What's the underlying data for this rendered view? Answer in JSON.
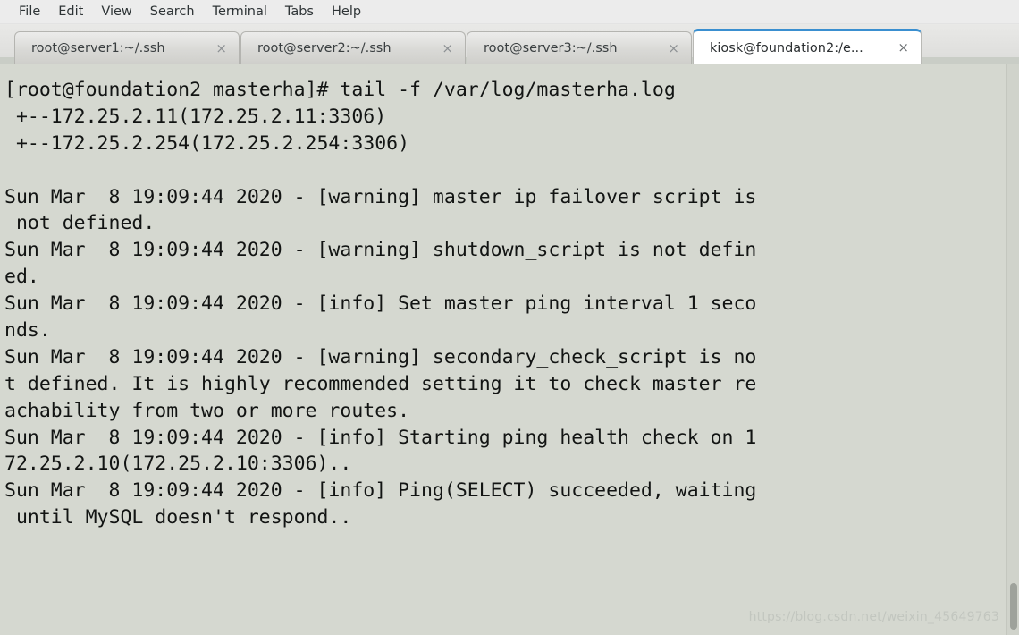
{
  "menubar": {
    "items": [
      {
        "label": "File"
      },
      {
        "label": "Edit"
      },
      {
        "label": "View"
      },
      {
        "label": "Search"
      },
      {
        "label": "Terminal"
      },
      {
        "label": "Tabs"
      },
      {
        "label": "Help"
      }
    ]
  },
  "tabs": {
    "close_glyph": "×",
    "items": [
      {
        "label": "root@server1:~/.ssh",
        "active": false
      },
      {
        "label": "root@server2:~/.ssh",
        "active": false
      },
      {
        "label": "root@server3:~/.ssh",
        "active": false
      },
      {
        "label": "kiosk@foundation2:/e...",
        "active": true
      }
    ]
  },
  "terminal": {
    "prompt": "[root@foundation2 masterha]#",
    "command": "tail -f /var/log/masterha.log",
    "lines": [
      "[root@foundation2 masterha]# tail -f /var/log/masterha.log",
      " +--172.25.2.11(172.25.2.11:3306)",
      " +--172.25.2.254(172.25.2.254:3306)",
      "",
      "Sun Mar  8 19:09:44 2020 - [warning] master_ip_failover_script is",
      " not defined.",
      "Sun Mar  8 19:09:44 2020 - [warning] shutdown_script is not defin",
      "ed.",
      "Sun Mar  8 19:09:44 2020 - [info] Set master ping interval 1 seco",
      "nds.",
      "Sun Mar  8 19:09:44 2020 - [warning] secondary_check_script is no",
      "t defined. It is highly recommended setting it to check master re",
      "achability from two or more routes.",
      "Sun Mar  8 19:09:44 2020 - [info] Starting ping health check on 1",
      "72.25.2.10(172.25.2.10:3306)..",
      "Sun Mar  8 19:09:44 2020 - [info] Ping(SELECT) succeeded, waiting",
      " until MySQL doesn't respond.."
    ]
  },
  "watermark": {
    "text": "https://blog.csdn.net/weixin_45649763"
  },
  "colors": {
    "terminal_bg": "#d5d8d0",
    "terminal_fg": "#121413",
    "menubar_bg": "#ececec",
    "tab_active_accent": "#3a8fd0",
    "tab_active_bg": "#ffffff"
  }
}
